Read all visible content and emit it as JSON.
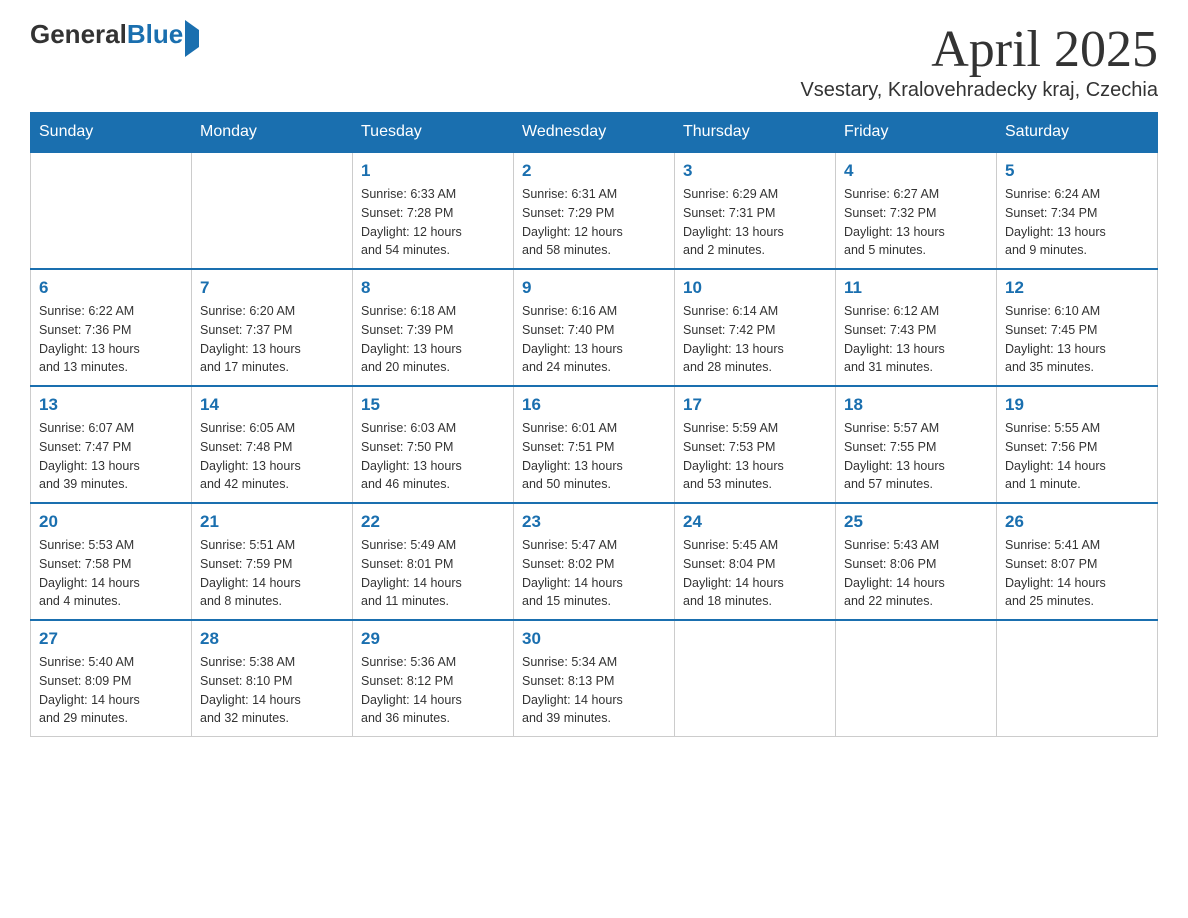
{
  "header": {
    "logo": {
      "general": "General",
      "blue": "Blue"
    },
    "month": "April 2025",
    "location": "Vsestary, Kralovehradecky kraj, Czechia"
  },
  "weekdays": [
    "Sunday",
    "Monday",
    "Tuesday",
    "Wednesday",
    "Thursday",
    "Friday",
    "Saturday"
  ],
  "weeks": [
    [
      {
        "day": "",
        "info": ""
      },
      {
        "day": "",
        "info": ""
      },
      {
        "day": "1",
        "info": "Sunrise: 6:33 AM\nSunset: 7:28 PM\nDaylight: 12 hours\nand 54 minutes."
      },
      {
        "day": "2",
        "info": "Sunrise: 6:31 AM\nSunset: 7:29 PM\nDaylight: 12 hours\nand 58 minutes."
      },
      {
        "day": "3",
        "info": "Sunrise: 6:29 AM\nSunset: 7:31 PM\nDaylight: 13 hours\nand 2 minutes."
      },
      {
        "day": "4",
        "info": "Sunrise: 6:27 AM\nSunset: 7:32 PM\nDaylight: 13 hours\nand 5 minutes."
      },
      {
        "day": "5",
        "info": "Sunrise: 6:24 AM\nSunset: 7:34 PM\nDaylight: 13 hours\nand 9 minutes."
      }
    ],
    [
      {
        "day": "6",
        "info": "Sunrise: 6:22 AM\nSunset: 7:36 PM\nDaylight: 13 hours\nand 13 minutes."
      },
      {
        "day": "7",
        "info": "Sunrise: 6:20 AM\nSunset: 7:37 PM\nDaylight: 13 hours\nand 17 minutes."
      },
      {
        "day": "8",
        "info": "Sunrise: 6:18 AM\nSunset: 7:39 PM\nDaylight: 13 hours\nand 20 minutes."
      },
      {
        "day": "9",
        "info": "Sunrise: 6:16 AM\nSunset: 7:40 PM\nDaylight: 13 hours\nand 24 minutes."
      },
      {
        "day": "10",
        "info": "Sunrise: 6:14 AM\nSunset: 7:42 PM\nDaylight: 13 hours\nand 28 minutes."
      },
      {
        "day": "11",
        "info": "Sunrise: 6:12 AM\nSunset: 7:43 PM\nDaylight: 13 hours\nand 31 minutes."
      },
      {
        "day": "12",
        "info": "Sunrise: 6:10 AM\nSunset: 7:45 PM\nDaylight: 13 hours\nand 35 minutes."
      }
    ],
    [
      {
        "day": "13",
        "info": "Sunrise: 6:07 AM\nSunset: 7:47 PM\nDaylight: 13 hours\nand 39 minutes."
      },
      {
        "day": "14",
        "info": "Sunrise: 6:05 AM\nSunset: 7:48 PM\nDaylight: 13 hours\nand 42 minutes."
      },
      {
        "day": "15",
        "info": "Sunrise: 6:03 AM\nSunset: 7:50 PM\nDaylight: 13 hours\nand 46 minutes."
      },
      {
        "day": "16",
        "info": "Sunrise: 6:01 AM\nSunset: 7:51 PM\nDaylight: 13 hours\nand 50 minutes."
      },
      {
        "day": "17",
        "info": "Sunrise: 5:59 AM\nSunset: 7:53 PM\nDaylight: 13 hours\nand 53 minutes."
      },
      {
        "day": "18",
        "info": "Sunrise: 5:57 AM\nSunset: 7:55 PM\nDaylight: 13 hours\nand 57 minutes."
      },
      {
        "day": "19",
        "info": "Sunrise: 5:55 AM\nSunset: 7:56 PM\nDaylight: 14 hours\nand 1 minute."
      }
    ],
    [
      {
        "day": "20",
        "info": "Sunrise: 5:53 AM\nSunset: 7:58 PM\nDaylight: 14 hours\nand 4 minutes."
      },
      {
        "day": "21",
        "info": "Sunrise: 5:51 AM\nSunset: 7:59 PM\nDaylight: 14 hours\nand 8 minutes."
      },
      {
        "day": "22",
        "info": "Sunrise: 5:49 AM\nSunset: 8:01 PM\nDaylight: 14 hours\nand 11 minutes."
      },
      {
        "day": "23",
        "info": "Sunrise: 5:47 AM\nSunset: 8:02 PM\nDaylight: 14 hours\nand 15 minutes."
      },
      {
        "day": "24",
        "info": "Sunrise: 5:45 AM\nSunset: 8:04 PM\nDaylight: 14 hours\nand 18 minutes."
      },
      {
        "day": "25",
        "info": "Sunrise: 5:43 AM\nSunset: 8:06 PM\nDaylight: 14 hours\nand 22 minutes."
      },
      {
        "day": "26",
        "info": "Sunrise: 5:41 AM\nSunset: 8:07 PM\nDaylight: 14 hours\nand 25 minutes."
      }
    ],
    [
      {
        "day": "27",
        "info": "Sunrise: 5:40 AM\nSunset: 8:09 PM\nDaylight: 14 hours\nand 29 minutes."
      },
      {
        "day": "28",
        "info": "Sunrise: 5:38 AM\nSunset: 8:10 PM\nDaylight: 14 hours\nand 32 minutes."
      },
      {
        "day": "29",
        "info": "Sunrise: 5:36 AM\nSunset: 8:12 PM\nDaylight: 14 hours\nand 36 minutes."
      },
      {
        "day": "30",
        "info": "Sunrise: 5:34 AM\nSunset: 8:13 PM\nDaylight: 14 hours\nand 39 minutes."
      },
      {
        "day": "",
        "info": ""
      },
      {
        "day": "",
        "info": ""
      },
      {
        "day": "",
        "info": ""
      }
    ]
  ]
}
